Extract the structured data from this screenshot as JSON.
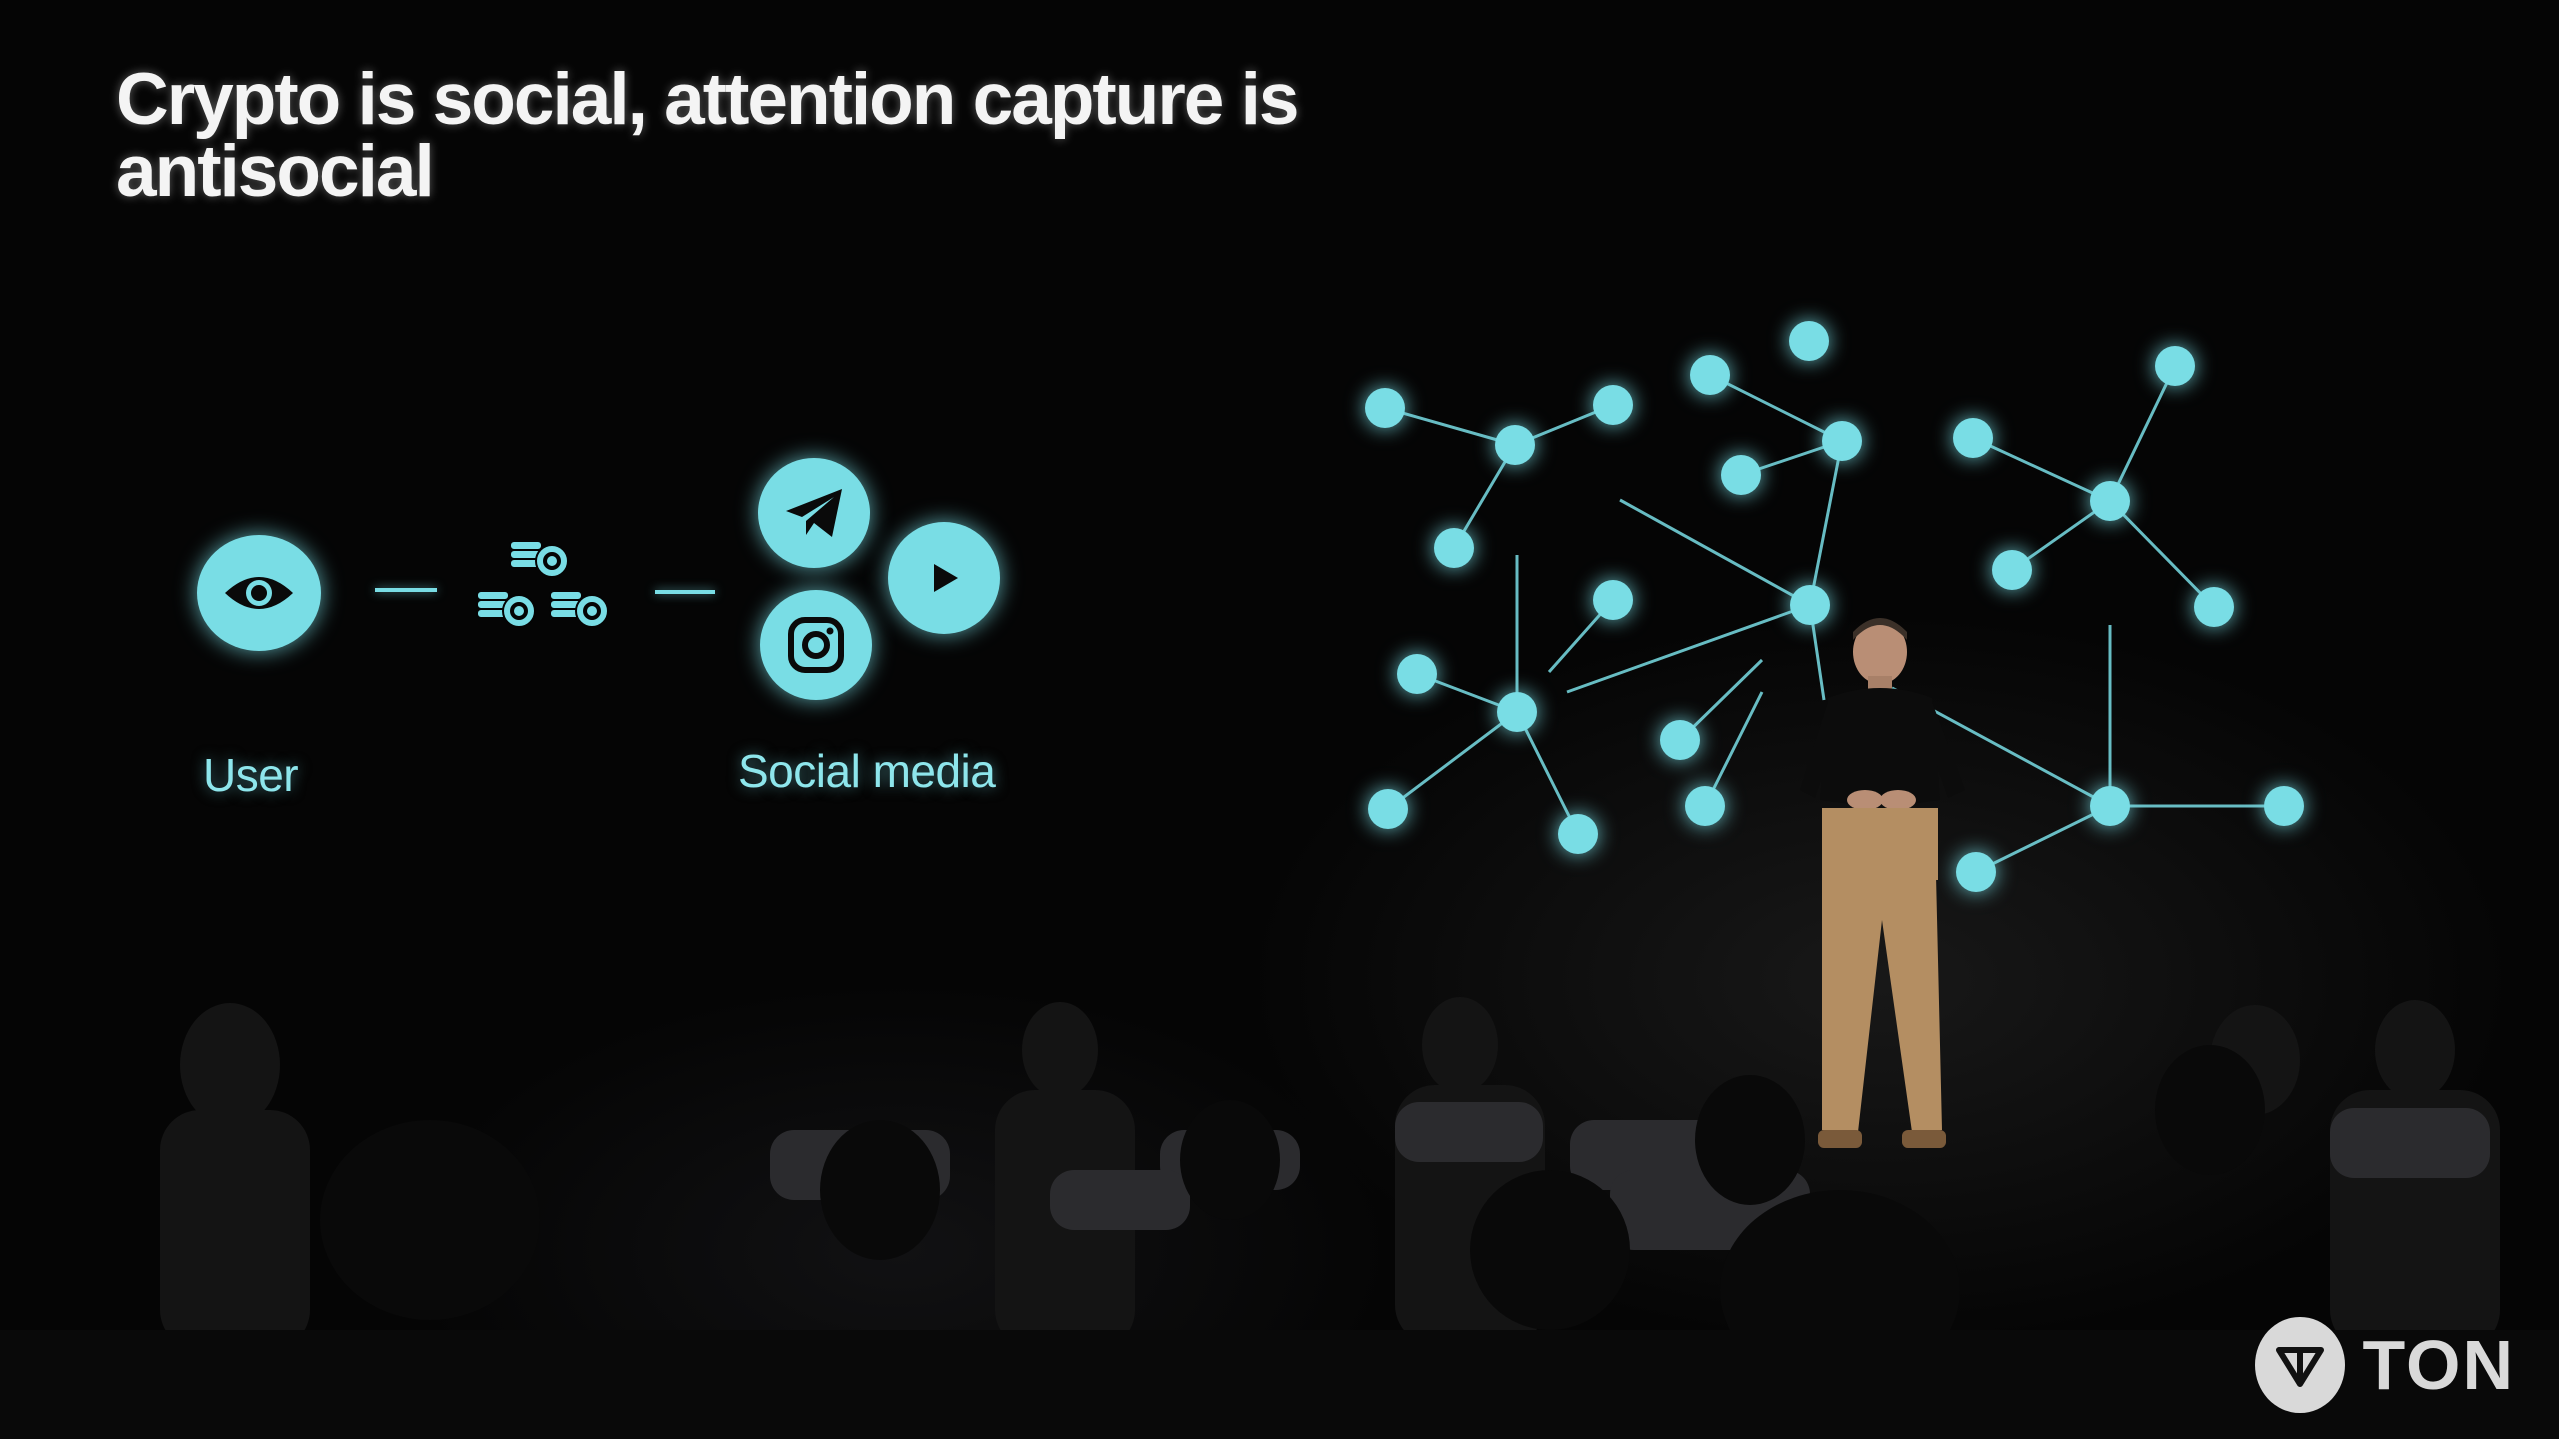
{
  "slide": {
    "title": "Crypto is social, attention capture is antisocial"
  },
  "flow": {
    "user_label": "User",
    "social_label": "Social media",
    "icons": {
      "user": "eye-icon",
      "money": "coins-icon",
      "platforms": [
        "telegram-icon",
        "instagram-icon",
        "play-icon"
      ]
    }
  },
  "network": {
    "node_color": "#79dde5"
  },
  "branding": {
    "logo_text": "TON"
  },
  "colors": {
    "accent": "#79dde5",
    "background": "#050505",
    "title": "#f4f4f4"
  }
}
